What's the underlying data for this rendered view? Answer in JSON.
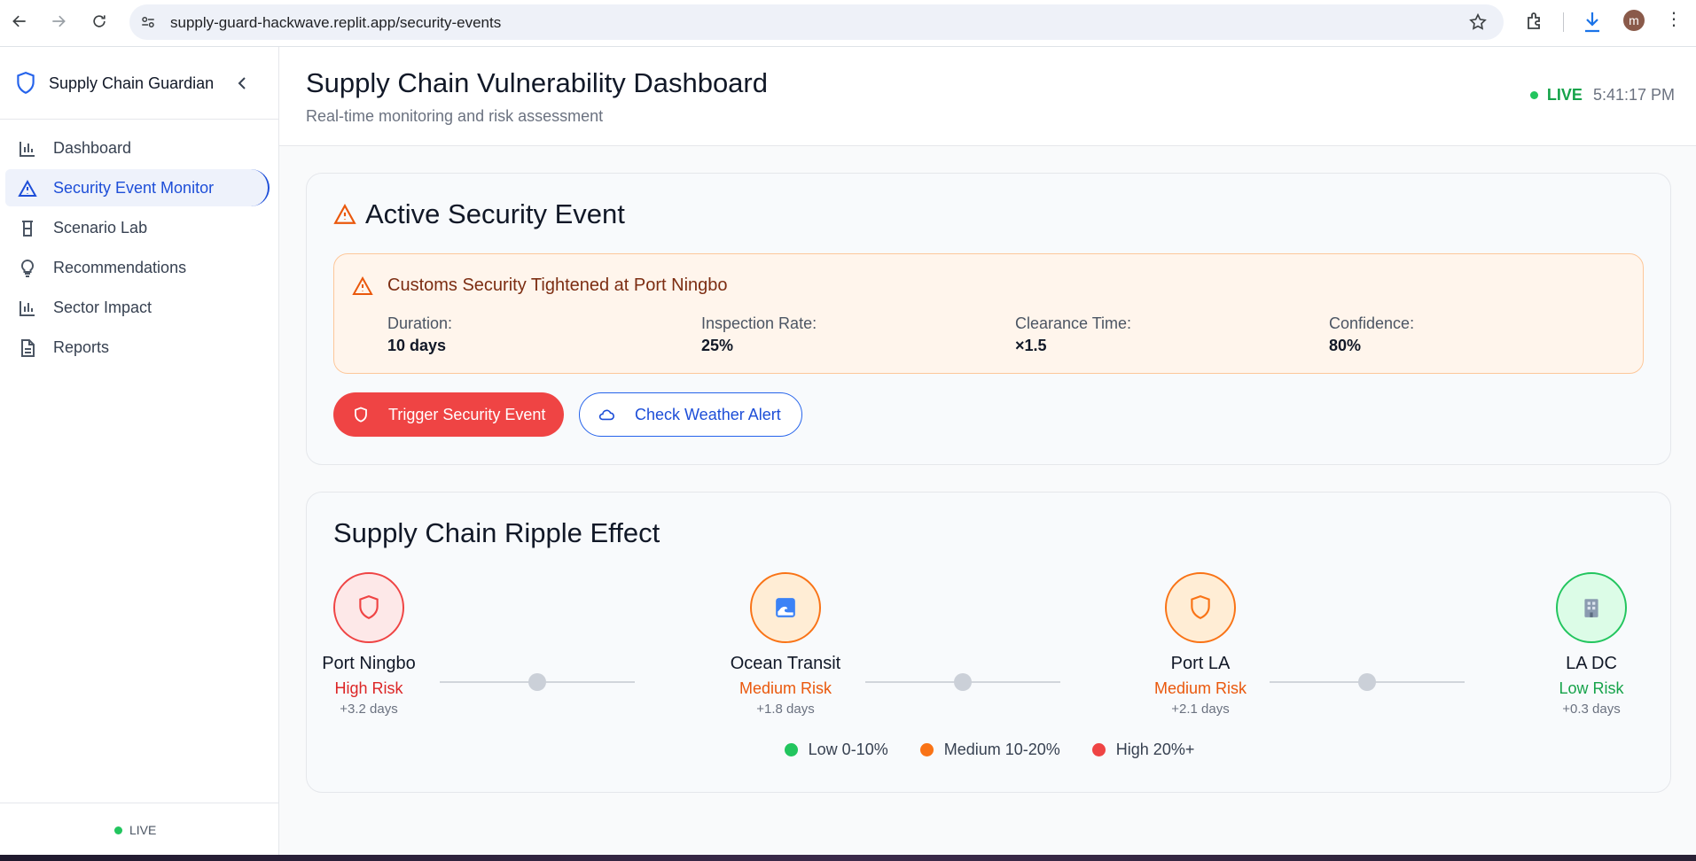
{
  "browser": {
    "url": "supply-guard-hackwave.replit.app/security-events",
    "profile_initial": "m"
  },
  "sidebar": {
    "title": "Supply Chain Guardian",
    "items": [
      {
        "label": "Dashboard",
        "icon": "bar-chart-icon"
      },
      {
        "label": "Security Event Monitor",
        "icon": "alert-triangle-icon",
        "active": true
      },
      {
        "label": "Scenario Lab",
        "icon": "beaker-icon"
      },
      {
        "label": "Recommendations",
        "icon": "lightbulb-icon"
      },
      {
        "label": "Sector Impact",
        "icon": "bar-chart-icon"
      },
      {
        "label": "Reports",
        "icon": "file-text-icon"
      }
    ],
    "footer_status": "LIVE"
  },
  "header": {
    "title": "Supply Chain Vulnerability Dashboard",
    "subtitle": "Real-time monitoring and risk assessment",
    "live_label": "LIVE",
    "time": "5:41:17 PM"
  },
  "active_event": {
    "title": "Active Security Event",
    "event_name": "Customs Security Tightened at Port Ningbo",
    "metrics": [
      {
        "label": "Duration:",
        "value": "10 days"
      },
      {
        "label": "Inspection Rate:",
        "value": "25%"
      },
      {
        "label": "Clearance Time:",
        "value": "×1.5"
      },
      {
        "label": "Confidence:",
        "value": "80%"
      }
    ],
    "trigger_button": "Trigger Security Event",
    "weather_button": "Check Weather Alert"
  },
  "ripple": {
    "title": "Supply Chain Ripple Effect",
    "nodes": [
      {
        "name": "Port Ningbo",
        "risk": "High Risk",
        "delay": "+3.2 days",
        "level": "high",
        "icon": "shield-icon"
      },
      {
        "name": "Ocean Transit",
        "risk": "Medium Risk",
        "delay": "+1.8 days",
        "level": "medium",
        "icon": "wave-icon"
      },
      {
        "name": "Port LA",
        "risk": "Medium Risk",
        "delay": "+2.1 days",
        "level": "medium",
        "icon": "shield-icon"
      },
      {
        "name": "LA DC",
        "risk": "Low Risk",
        "delay": "+0.3 days",
        "level": "low",
        "icon": "building-icon"
      }
    ],
    "legend": [
      {
        "label": "Low 0-10%",
        "color": "#22c55e"
      },
      {
        "label": "Medium 10-20%",
        "color": "#f97316"
      },
      {
        "label": "High 20%+",
        "color": "#ef4444"
      }
    ]
  }
}
